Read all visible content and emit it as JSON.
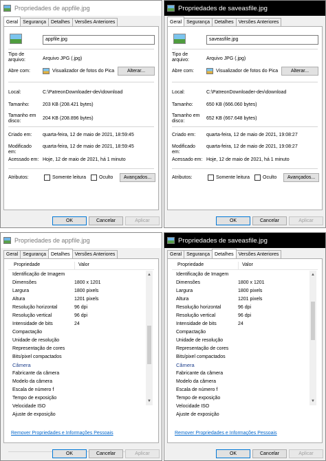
{
  "tabs": [
    "Geral",
    "Segurança",
    "Detalhes",
    "Versões Anteriores"
  ],
  "labels": {
    "tipo": "Tipo de arquivo:",
    "abre_com": "Abre com:",
    "local": "Local:",
    "tamanho": "Tamanho:",
    "tamanho_disco": "Tamanho em disco:",
    "criado": "Criado em:",
    "modificado": "Modificado em:",
    "acessado": "Acessado em:",
    "atributos": "Atributos:",
    "somente_leitura": "Somente leitura",
    "oculto": "Oculto",
    "alterar": "Alterar...",
    "avancados": "Avançados...",
    "ok": "OK",
    "cancelar": "Cancelar",
    "aplicar": "Aplicar",
    "col_propriedade": "Propriedade",
    "col_valor": "Valor",
    "remover_link": "Remover Propriedades e Informações Pessoais"
  },
  "app_file": {
    "title": "Propriedades de appfile.jpg",
    "name": "appfile.jpg",
    "tipo": "Arquivo JPG (.jpg)",
    "abre_com": "Visualizador de fotos do Pica",
    "local": "C:\\PatreonDownloader-dev\\download",
    "tamanho": "203 KB (208.421 bytes)",
    "tamanho_disco": "204 KB (208.896 bytes)",
    "criado": "quarta-feira, 12 de maio de 2021, 18:59:45",
    "modificado": "quarta-feira, 12 de maio de 2021, 18:59:45",
    "acessado": "Hoje, 12 de maio de 2021, há 1 minuto"
  },
  "save_file": {
    "title": "Propriedades de saveasfile.jpg",
    "name": "saveasfile.jpg",
    "tipo": "Arquivo JPG (.jpg)",
    "abre_com": "Visualizador de fotos do Pica",
    "local": "C:\\PatreonDownloader-dev\\download",
    "tamanho": "650 KB (666.060 bytes)",
    "tamanho_disco": "652 KB (667.648 bytes)",
    "criado": "quarta-feira, 12 de maio de 2021, 19:08:27",
    "modificado": "quarta-feira, 12 de maio de 2021, 19:08:27",
    "acessado": "Hoje, 12 de maio de 2021, há 1 minuto"
  },
  "details": [
    {
      "p": "Identificação de Imagem",
      "v": ""
    },
    {
      "p": "Dimensões",
      "v": "1800 x 1201"
    },
    {
      "p": "Largura",
      "v": "1800 pixels"
    },
    {
      "p": "Altura",
      "v": "1201 pixels"
    },
    {
      "p": "Resolução horizontal",
      "v": "96 dpi"
    },
    {
      "p": "Resolução vertical",
      "v": "96 dpi"
    },
    {
      "p": "Intensidade de bits",
      "v": "24"
    },
    {
      "p": "Compactação",
      "v": ""
    },
    {
      "p": "Unidade de resolução",
      "v": ""
    },
    {
      "p": "Representação de cores",
      "v": ""
    },
    {
      "p": "Bits/pixel compactados",
      "v": ""
    },
    {
      "p": "Câmera",
      "v": "",
      "cat": true
    },
    {
      "p": "Fabricante da câmera",
      "v": ""
    },
    {
      "p": "Modelo da câmera",
      "v": ""
    },
    {
      "p": "Escala de número f",
      "v": ""
    },
    {
      "p": "Tempo de exposição",
      "v": ""
    },
    {
      "p": "Velocidade ISO",
      "v": ""
    },
    {
      "p": "Ajuste de exposição",
      "v": ""
    }
  ]
}
